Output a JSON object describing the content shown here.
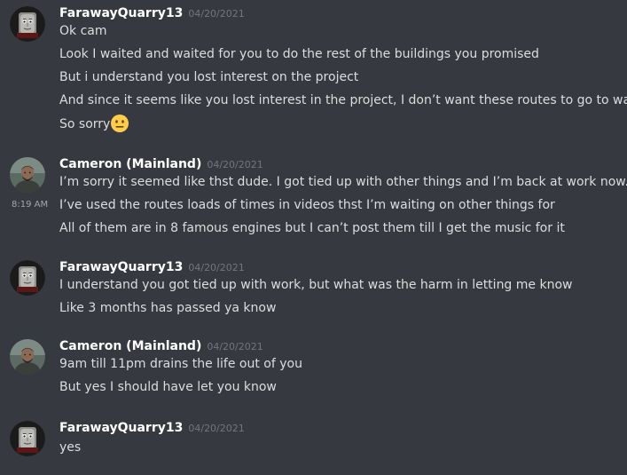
{
  "messages": [
    {
      "author": "FarawayQuarry13",
      "timestamp": "04/20/2021",
      "avatar": "thomas-face-avatar",
      "lines": [
        "Ok cam",
        "Look I waited and waited for you to do the rest of the buildings you promised",
        "But i understand you lost interest on the project",
        "And since it seems like you lost interest in the project, I don’t want these routes to go to waste",
        "So sorry"
      ],
      "emoji": "neutral-face-emoji"
    },
    {
      "author": "Cameron (Mainland)",
      "timestamp": "04/20/2021",
      "avatar": "person-photo-avatar",
      "hover_time": "8:19 AM",
      "lines": [
        "I’m sorry it seemed like thst dude. I got tied up with other things and I’m back at work now.",
        "I’ve used the routes loads of times in videos thst I’m waiting on other things for",
        "All of them are in 8 famous engines but I can’t post them till I get the music for it"
      ]
    },
    {
      "author": "FarawayQuarry13",
      "timestamp": "04/20/2021",
      "avatar": "thomas-face-avatar",
      "lines": [
        "I understand you got tied up with work, but what was the harm in letting me know",
        "Like 3 months has passed ya know"
      ]
    },
    {
      "author": "Cameron (Mainland)",
      "timestamp": "04/20/2021",
      "avatar": "person-photo-avatar",
      "lines": [
        "9am till 11pm drains the life out of you",
        "But yes I should have let you know"
      ]
    },
    {
      "author": "FarawayQuarry13",
      "timestamp": "04/20/2021",
      "avatar": "thomas-face-avatar",
      "lines": [
        "yes"
      ]
    }
  ],
  "colors": {
    "background": "#36393f",
    "hover_row": "#32353b",
    "username": "#ffffff",
    "timestamp": "#72767d",
    "text": "#dcddde"
  }
}
